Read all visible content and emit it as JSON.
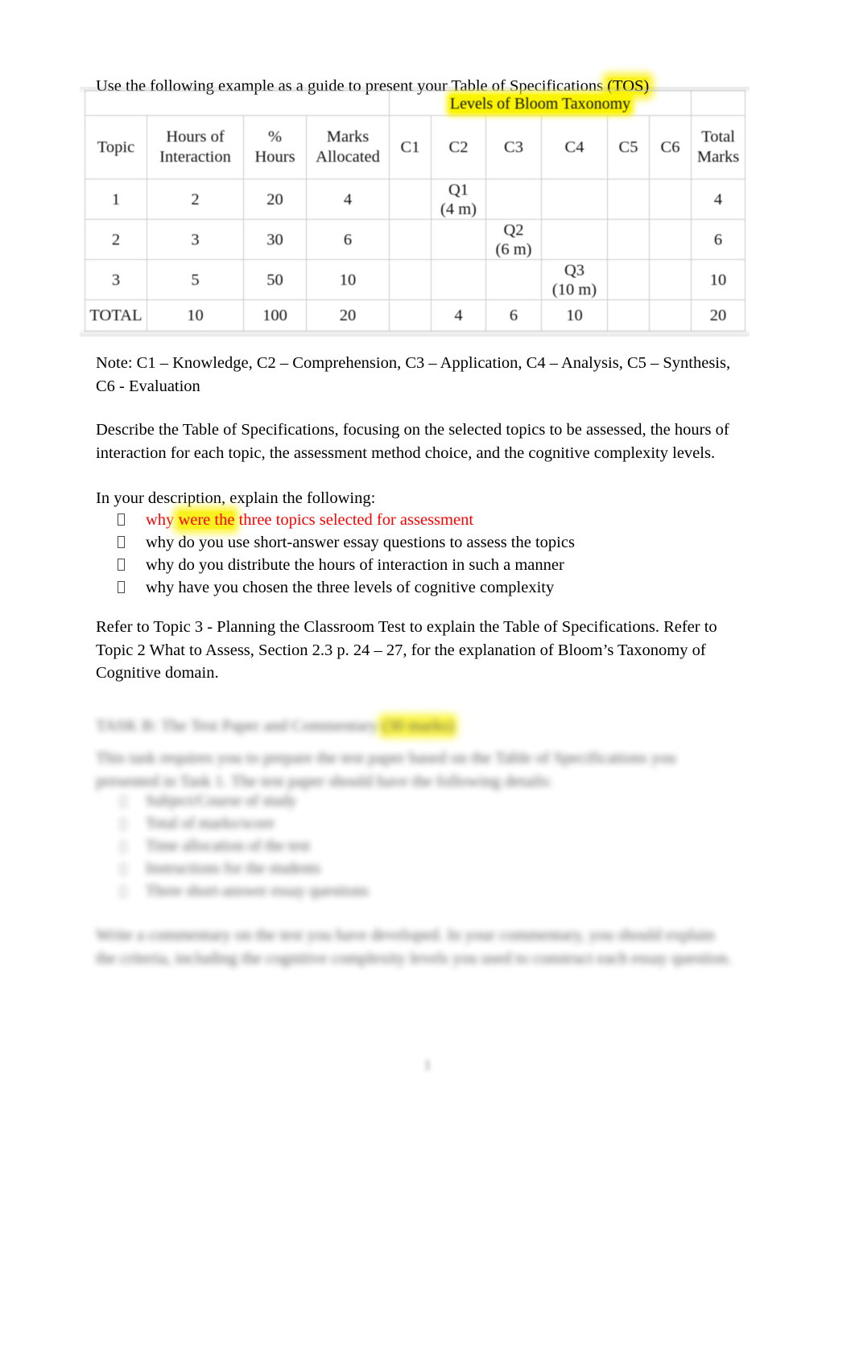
{
  "document": {
    "intro": {
      "text_before": "Use the following example as a guide to present your Table of Specifications",
      "highlight": "(TOS)"
    },
    "table": {
      "group_header": "Levels of Bloom Taxonomy",
      "columns": [
        "Topic",
        "Hours of Interaction",
        "% Hours",
        "Marks Allocated",
        "C1",
        "C2",
        "C3",
        "C4",
        "C5",
        "C6",
        "Total Marks"
      ],
      "columns_split": {
        "topic": "Topic",
        "hours_line1": "Hours of",
        "hours_line2": "Interaction",
        "pct_line1": "%",
        "pct_line2": "Hours",
        "marks_line1": "Marks",
        "marks_line2": "Allocated",
        "c1": "C1",
        "c2": "C2",
        "c3": "C3",
        "c4": "C4",
        "c5": "C5",
        "c6": "C6",
        "total_line1": "Total",
        "total_line2": "Marks"
      },
      "rows": [
        {
          "topic": "1",
          "hours_of_interaction": "2",
          "pct_hours": "20",
          "marks_allocated": "4",
          "c1": "",
          "c2_q": "Q1",
          "c2_m": "(4 m)",
          "c3": "",
          "c4": "",
          "c5": "",
          "c6": "",
          "total_marks": "4"
        },
        {
          "topic": "2",
          "hours_of_interaction": "3",
          "pct_hours": "30",
          "marks_allocated": "6",
          "c1": "",
          "c2": "",
          "c3_q": "Q2",
          "c3_m": "(6 m)",
          "c4": "",
          "c5": "",
          "c6": "",
          "total_marks": "6"
        },
        {
          "topic": "3",
          "hours_of_interaction": "5",
          "pct_hours": "50",
          "marks_allocated": "10",
          "c1": "",
          "c2": "",
          "c3": "",
          "c4_q": "Q3",
          "c4_m": "(10 m)",
          "c5": "",
          "c6": "",
          "total_marks": "10"
        }
      ],
      "total_row": {
        "label": "TOTAL",
        "hours_of_interaction": "10",
        "pct_hours": "100",
        "marks_allocated": "20",
        "c1": "",
        "c2": "4",
        "c3": "6",
        "c4": "10",
        "c5": "",
        "c6": "",
        "total_marks": "20"
      }
    },
    "note": "Note: C1 – Knowledge, C2 – Comprehension, C3 – Application, C4 – Analysis, C5 – Synthesis, C6 - Evaluation",
    "describe_paragraph": "Describe the Table of Specifications, focusing on the selected topics to be assessed, the hours of interaction for each topic, the assessment method choice, and the cognitive complexity levels.",
    "in_your_description": "In your description, explain the following:",
    "bullets": [
      {
        "prefix": "why ",
        "highlight": "were the",
        "suffix": " three topics selected for assessment",
        "color": "#ff0000"
      },
      {
        "text": "why do you use short-answer essay questions to assess the topics"
      },
      {
        "text": "why do you distribute the hours of interaction in such a manner"
      },
      {
        "text": "why have you chosen the three levels of cognitive complexity"
      }
    ],
    "refer_paragraph": "Refer to Topic 3 - Planning the Classroom Test to explain the Table of Specifications. Refer to Topic 2 What to Assess, Section 2.3 p. 24 – 27, for the explanation of Bloom’s Taxonomy of Cognitive domain.",
    "obscured": {
      "heading": "TASK B: The Test Paper and Commentary",
      "heading_highlight": "(30 marks)",
      "paragraph": "This task requires you to prepare the test paper based on the Table of Specifications you presented in Task 1. The test paper should have the following details:",
      "bullets": [
        "Subject/Course of study",
        "Total of marks/score",
        "Time allocation of the test",
        "Instructions for the students",
        "Three short-answer essay questions"
      ],
      "closing": "Write a commentary on the test you have developed. In your commentary, you should explain the criteria, including the cognitive complexity levels you used to construct each essay question.",
      "page_number": "1"
    },
    "colors": {
      "highlight_yellow": "#fbf400",
      "red_text": "#ff0000",
      "table_border": "#c9c9c9"
    }
  }
}
